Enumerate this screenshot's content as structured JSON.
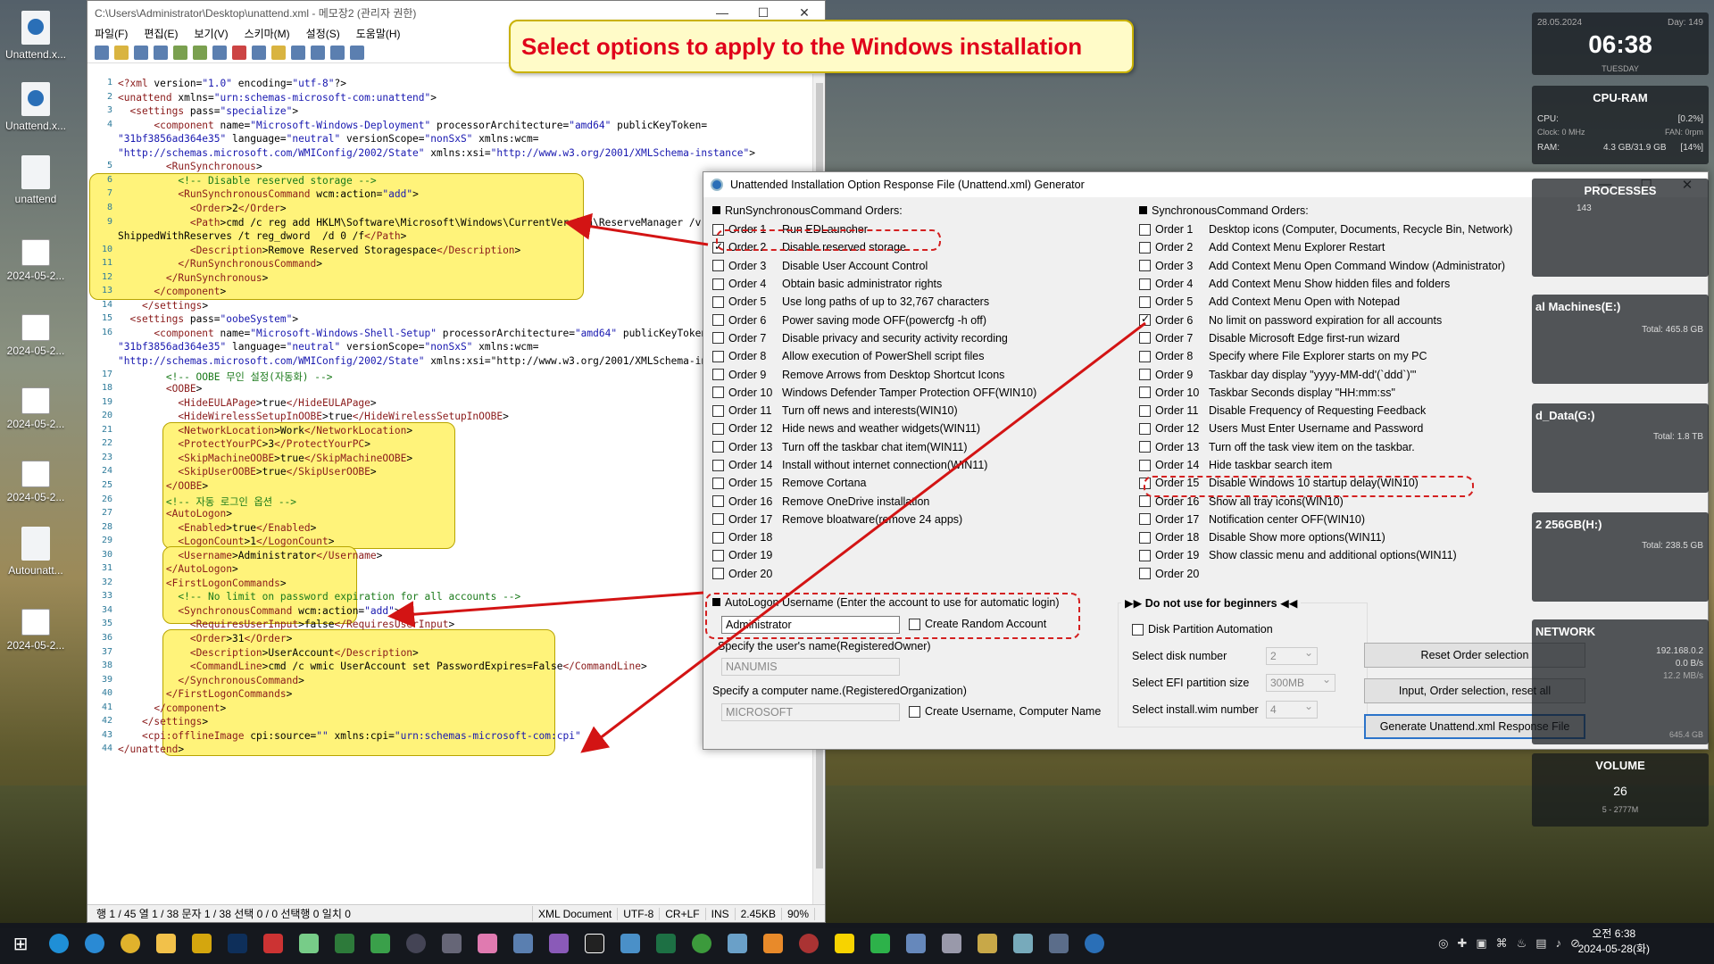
{
  "desktop": {
    "icons": [
      "Unattend.x...",
      "Unattend.x...",
      "unattend",
      "2024-05-2...",
      "2024-05-2...",
      "2024-05-2...",
      "2024-05-2...",
      "Autounatt...",
      "2024-05-2..."
    ]
  },
  "notepad": {
    "title": "C:\\Users\\Administrator\\Desktop\\unattend.xml - 메모장2 (관리자 권한)",
    "menu": [
      "파일(F)",
      "편집(E)",
      "보기(V)",
      "스키마(M)",
      "설정(S)",
      "도움말(H)"
    ],
    "lines": [
      {
        "n": "1",
        "t": "<?xml version=\"1.0\" encoding=\"utf-8\"?>"
      },
      {
        "n": "2",
        "t": "<unattend xmlns=\"urn:schemas-microsoft-com:unattend\">"
      },
      {
        "n": "3",
        "t": "  <settings pass=\"specialize\">"
      },
      {
        "n": "4",
        "t": "      <component name=\"Microsoft-Windows-Deployment\" processorArchitecture=\"amd64\" publicKeyToken="
      },
      {
        "n": "",
        "t": "\"31bf3856ad364e35\" language=\"neutral\" versionScope=\"nonSxS\" xmlns:wcm="
      },
      {
        "n": "",
        "t": "\"http://schemas.microsoft.com/WMIConfig/2002/State\" xmlns:xsi=\"http://www.w3.org/2001/XMLSchema-instance\">"
      },
      {
        "n": "5",
        "t": "        <RunSynchronous>"
      },
      {
        "n": "6",
        "t": "          <!-- Disable reserved storage -->"
      },
      {
        "n": "7",
        "t": "          <RunSynchronousCommand wcm:action=\"add\">"
      },
      {
        "n": "8",
        "t": "            <Order>2</Order>"
      },
      {
        "n": "9",
        "t": "            <Path>cmd /c reg add HKLM\\Software\\Microsoft\\Windows\\CurrentVersion\\ReserveManager /v"
      },
      {
        "n": "",
        "t": "ShippedWithReserves /t reg_dword  /d 0 /f</Path>"
      },
      {
        "n": "10",
        "t": "            <Description>Remove Reserved Storagespace</Description>"
      },
      {
        "n": "11",
        "t": "          </RunSynchronousCommand>"
      },
      {
        "n": "12",
        "t": "        </RunSynchronous>"
      },
      {
        "n": "13",
        "t": "      </component>"
      },
      {
        "n": "14",
        "t": "    </settings>"
      },
      {
        "n": "15",
        "t": "  <settings pass=\"oobeSystem\">"
      },
      {
        "n": "16",
        "t": "      <component name=\"Microsoft-Windows-Shell-Setup\" processorArchitecture=\"amd64\" publicKeyToken="
      },
      {
        "n": "",
        "t": "\"31bf3856ad364e35\" language=\"neutral\" versionScope=\"nonSxS\" xmlns:wcm="
      },
      {
        "n": "",
        "t": "\"http://schemas.microsoft.com/WMIConfig/2002/State\" xmlns:xsi=\"http://www.w3.org/2001/XMLSchema-inst"
      },
      {
        "n": "17",
        "t": "        <!-- OOBE 무인 설정(자동화) -->"
      },
      {
        "n": "18",
        "t": "        <OOBE>"
      },
      {
        "n": "19",
        "t": "          <HideEULAPage>true</HideEULAPage>"
      },
      {
        "n": "20",
        "t": "          <HideWirelessSetupInOOBE>true</HideWirelessSetupInOOBE>"
      },
      {
        "n": "21",
        "t": "          <NetworkLocation>Work</NetworkLocation>"
      },
      {
        "n": "22",
        "t": "          <ProtectYourPC>3</ProtectYourPC>"
      },
      {
        "n": "23",
        "t": "          <SkipMachineOOBE>true</SkipMachineOOBE>"
      },
      {
        "n": "24",
        "t": "          <SkipUserOOBE>true</SkipUserOOBE>"
      },
      {
        "n": "25",
        "t": "        </OOBE>"
      },
      {
        "n": "26",
        "t": "        <!-- 자동 로그인 옵션 -->"
      },
      {
        "n": "27",
        "t": "        <AutoLogon>"
      },
      {
        "n": "28",
        "t": "          <Enabled>true</Enabled>"
      },
      {
        "n": "29",
        "t": "          <LogonCount>1</LogonCount>"
      },
      {
        "n": "30",
        "t": "          <Username>Administrator</Username>"
      },
      {
        "n": "31",
        "t": "        </AutoLogon>"
      },
      {
        "n": "32",
        "t": "        <FirstLogonCommands>"
      },
      {
        "n": "33",
        "t": "          <!-- No limit on password expiration for all accounts -->"
      },
      {
        "n": "34",
        "t": "          <SynchronousCommand wcm:action=\"add\">"
      },
      {
        "n": "35",
        "t": "            <RequiresUserInput>false</RequiresUserInput>"
      },
      {
        "n": "36",
        "t": "            <Order>31</Order>"
      },
      {
        "n": "37",
        "t": "            <Description>UserAccount</Description>"
      },
      {
        "n": "38",
        "t": "            <CommandLine>cmd /c wmic UserAccount set PasswordExpires=False</CommandLine>"
      },
      {
        "n": "39",
        "t": "          </SynchronousCommand>"
      },
      {
        "n": "40",
        "t": "        </FirstLogonCommands>"
      },
      {
        "n": "41",
        "t": "      </component>"
      },
      {
        "n": "42",
        "t": "    </settings>"
      },
      {
        "n": "43",
        "t": "    <cpi:offlineImage cpi:source=\"\" xmlns:cpi=\"urn:schemas-microsoft-com:cpi\" />"
      },
      {
        "n": "44",
        "t": "</unattend>"
      }
    ],
    "status": [
      "행 1 / 45  열 1 / 38  문자 1 / 38  선택 0 / 0  선택행 0  일치 0",
      "XML Document",
      "UTF-8",
      "CR+LF",
      "INS",
      "2.45KB",
      "90%"
    ]
  },
  "callout": "Select options to apply to the Windows installation",
  "dialog": {
    "title": "Unattended Installation Option Response File (Unattend.xml) Generator",
    "left_header": "RunSynchronousCommand Orders:",
    "left": [
      {
        "o": "Order 1",
        "d": "Run EDLauncher",
        "c": false
      },
      {
        "o": "Order 2",
        "d": "Disable reserved storage",
        "c": true
      },
      {
        "o": "Order 3",
        "d": "Disable User Account Control",
        "c": false
      },
      {
        "o": "Order 4",
        "d": "Obtain basic administrator rights",
        "c": false
      },
      {
        "o": "Order 5",
        "d": "Use long paths of up to 32,767 characters",
        "c": false
      },
      {
        "o": "Order 6",
        "d": "Power saving mode OFF(powercfg -h off)",
        "c": false
      },
      {
        "o": "Order 7",
        "d": "Disable privacy and security activity recording",
        "c": false
      },
      {
        "o": "Order 8",
        "d": "Allow execution of PowerShell script files",
        "c": false
      },
      {
        "o": "Order 9",
        "d": "Remove Arrows from Desktop Shortcut Icons",
        "c": false
      },
      {
        "o": "Order 10",
        "d": "Windows Defender Tamper Protection OFF(WIN10)",
        "c": false
      },
      {
        "o": "Order 11",
        "d": "Turn off news and interests(WIN10)",
        "c": false
      },
      {
        "o": "Order 12",
        "d": "Hide news and weather widgets(WIN11)",
        "c": false
      },
      {
        "o": "Order 13",
        "d": "Turn off the taskbar chat item(WIN11)",
        "c": false
      },
      {
        "o": "Order 14",
        "d": "Install without internet connection(WIN11)",
        "c": false
      },
      {
        "o": "Order 15",
        "d": "Remove Cortana",
        "c": false
      },
      {
        "o": "Order 16",
        "d": "Remove OneDrive installation",
        "c": false
      },
      {
        "o": "Order 17",
        "d": "Remove bloatware(remove 24 apps)",
        "c": false
      },
      {
        "o": "Order 18",
        "d": "",
        "c": false
      },
      {
        "o": "Order 19",
        "d": "",
        "c": false
      },
      {
        "o": "Order 20",
        "d": "",
        "c": false
      }
    ],
    "right_header": "SynchronousCommand Orders:",
    "right": [
      {
        "o": "Order 1",
        "d": "Desktop icons (Computer, Documents, Recycle Bin, Network)",
        "c": false
      },
      {
        "o": "Order 2",
        "d": "Add Context Menu Explorer Restart",
        "c": false
      },
      {
        "o": "Order 3",
        "d": "Add Context Menu Open Command Window (Administrator)",
        "c": false
      },
      {
        "o": "Order 4",
        "d": "Add Context Menu Show hidden files and folders",
        "c": false
      },
      {
        "o": "Order 5",
        "d": "Add Context Menu Open with Notepad",
        "c": false
      },
      {
        "o": "Order 6",
        "d": "No limit on password expiration for all accounts",
        "c": true
      },
      {
        "o": "Order 7",
        "d": "Disable Microsoft Edge first-run wizard",
        "c": false
      },
      {
        "o": "Order 8",
        "d": "Specify where File Explorer starts on my PC",
        "c": false
      },
      {
        "o": "Order 9",
        "d": "Taskbar day display \"yyyy-MM-dd'(`ddd`)'\"",
        "c": false
      },
      {
        "o": "Order 10",
        "d": "Taskbar Seconds display \"HH:mm:ss\"",
        "c": false
      },
      {
        "o": "Order 11",
        "d": "Disable Frequency of Requesting Feedback",
        "c": false
      },
      {
        "o": "Order 12",
        "d": "Users Must Enter Username and Password",
        "c": false
      },
      {
        "o": "Order 13",
        "d": "Turn off the task view item on the taskbar.",
        "c": false
      },
      {
        "o": "Order 14",
        "d": "Hide taskbar search item",
        "c": false
      },
      {
        "o": "Order 15",
        "d": "Disable Windows 10 startup delay(WIN10)",
        "c": false
      },
      {
        "o": "Order 16",
        "d": "Show all tray icons(WIN10)",
        "c": false
      },
      {
        "o": "Order 17",
        "d": "Notification center OFF(WIN10)",
        "c": false
      },
      {
        "o": "Order 18",
        "d": "Disable Show more options(WIN11)",
        "c": false
      },
      {
        "o": "Order 19",
        "d": "Show classic menu and additional options(WIN11)",
        "c": false
      },
      {
        "o": "Order 20",
        "d": "",
        "c": false
      }
    ],
    "autologon_label": "AutoLogon Username (Enter the account to use for automatic login)",
    "autologon_value": "Administrator",
    "random_account": "Create Random Account",
    "owner_label": "Specify the user's name(RegisteredOwner)",
    "owner_value": "NANUMIS",
    "org_label": "Specify a computer name.(RegisteredOrganization)",
    "org_value": "MICROSOFT",
    "create_names": "Create Username, Computer Name",
    "beginners": "▶▶ Do not use for beginners ◀◀",
    "disk_auto": "Disk Partition Automation",
    "disk_label": "Select disk number",
    "disk_value": "2",
    "efi_label": "Select EFI partition size",
    "efi_value": "300MB",
    "wim_label": "Select install.wim number",
    "wim_value": "4",
    "btn_reset": "Reset Order selection",
    "btn_input": "Input, Order selection, reset all",
    "btn_gen": "Generate Unattend.xml Response File"
  },
  "widgets": {
    "date": "28.05.2024",
    "day": "Day: 149",
    "time": "06:38",
    "weekday": "TUESDAY",
    "cpuram": "CPU-RAM",
    "cpu": "CPU:",
    "cpu_pct": "[0.2%]",
    "clock": "Clock: 0 MHz",
    "fan": "FAN: 0rpm",
    "ram": "RAM:",
    "ram_val": "4.3 GB/31.9 GB",
    "ram_pct": "[14%]",
    "processes": "PROCESSES",
    "proc_count": "143",
    "d1": "al Machines(E:)",
    "d1_total": "Total: 465.8 GB",
    "d2": "d_Data(G:)",
    "d2_total": "Total: 1.8 TB",
    "d3": "2 256GB(H:)",
    "d3_total": "Total: 238.5 GB",
    "network": "NETWORK",
    "ip": "192.168.0.2",
    "speed": "0.0 B/s",
    "peak": "12.2 MB/s",
    "net_total": "645.4 GB",
    "volume": "VOLUME",
    "vol": "26",
    "vol_sub": "5 - 2777M"
  },
  "clock": {
    "time": "오전 6:38",
    "date": "2024-05-28(화)"
  }
}
